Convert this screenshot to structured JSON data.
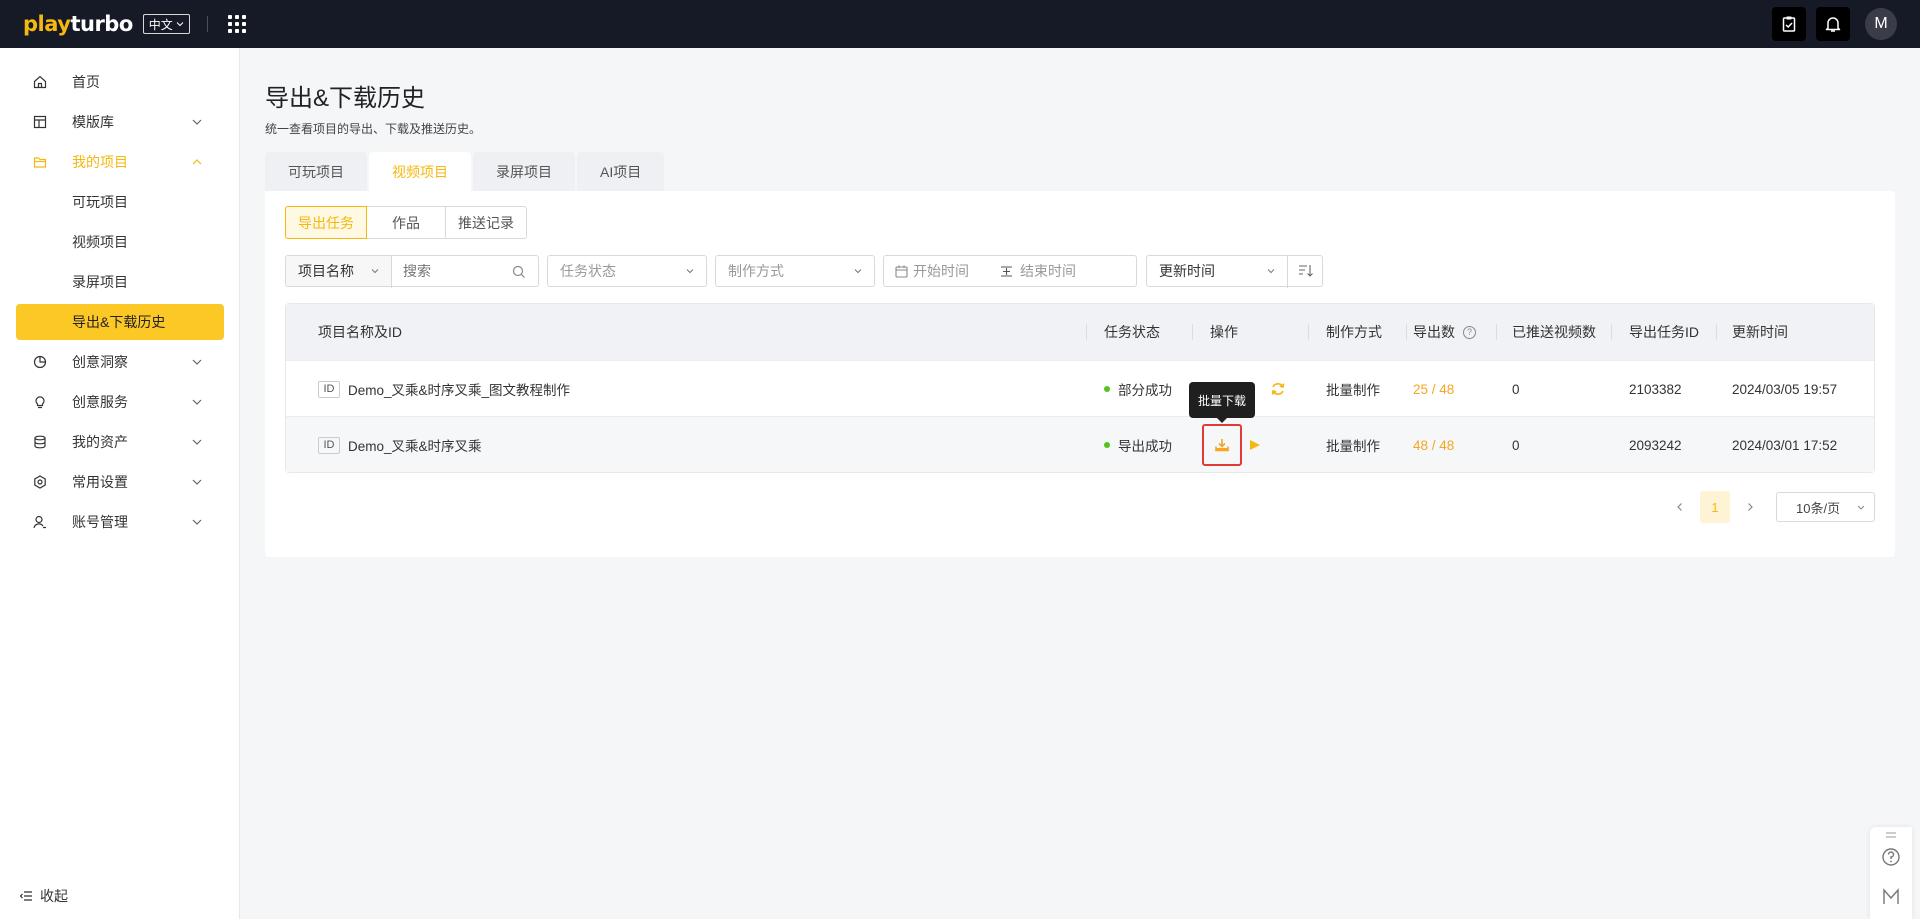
{
  "brand": {
    "logo_part1": "play",
    "logo_part2": "turbo",
    "lang": "中文"
  },
  "topbar": {
    "avatar_letter": "M"
  },
  "sidebar": {
    "items": [
      {
        "label": "首页"
      },
      {
        "label": "模版库"
      },
      {
        "label": "我的项目"
      },
      {
        "label": "可玩项目"
      },
      {
        "label": "视频项目"
      },
      {
        "label": "录屏项目"
      },
      {
        "label": "导出&下载历史"
      },
      {
        "label": "创意洞察"
      },
      {
        "label": "创意服务"
      },
      {
        "label": "我的资产"
      },
      {
        "label": "常用设置"
      },
      {
        "label": "账号管理"
      }
    ],
    "collapse_label": "收起"
  },
  "page": {
    "title": "导出&下载历史",
    "description": "统一查看项目的导出、下载及推送历史。"
  },
  "tabs": [
    "可玩项目",
    "视频项目",
    "录屏项目",
    "AI项目"
  ],
  "subtabs": [
    "导出任务",
    "作品",
    "推送记录"
  ],
  "filters": {
    "field_select": "项目名称",
    "search_placeholder": "搜索",
    "status_placeholder": "任务状态",
    "method_placeholder": "制作方式",
    "start_placeholder": "开始时间",
    "end_placeholder": "结束时间",
    "sort_select": "更新时间"
  },
  "table": {
    "headers": {
      "name": "项目名称及ID",
      "status": "任务状态",
      "action": "操作",
      "method": "制作方式",
      "export_count": "导出数",
      "pushed": "已推送视频数",
      "task_id": "导出任务ID",
      "updated": "更新时间"
    },
    "id_tag": "ID",
    "rows": [
      {
        "name": "Demo_叉乘&时序叉乘_图文教程制作",
        "status": "部分成功",
        "method": "批量制作",
        "export_count": "25 / 48",
        "pushed": "0",
        "task_id": "2103382",
        "updated": "2024/03/05 19:57"
      },
      {
        "name": "Demo_叉乘&时序叉乘",
        "status": "导出成功",
        "method": "批量制作",
        "export_count": "48 / 48",
        "pushed": "0",
        "task_id": "2093242",
        "updated": "2024/03/01 17:52"
      }
    ]
  },
  "tooltip": "批量下载",
  "pagination": {
    "current": "1",
    "page_size": "10条/页"
  },
  "colors": {
    "accent": "#f5b80e",
    "topbar": "#161a26",
    "success": "#52c41a",
    "highlight": "#e53935"
  }
}
